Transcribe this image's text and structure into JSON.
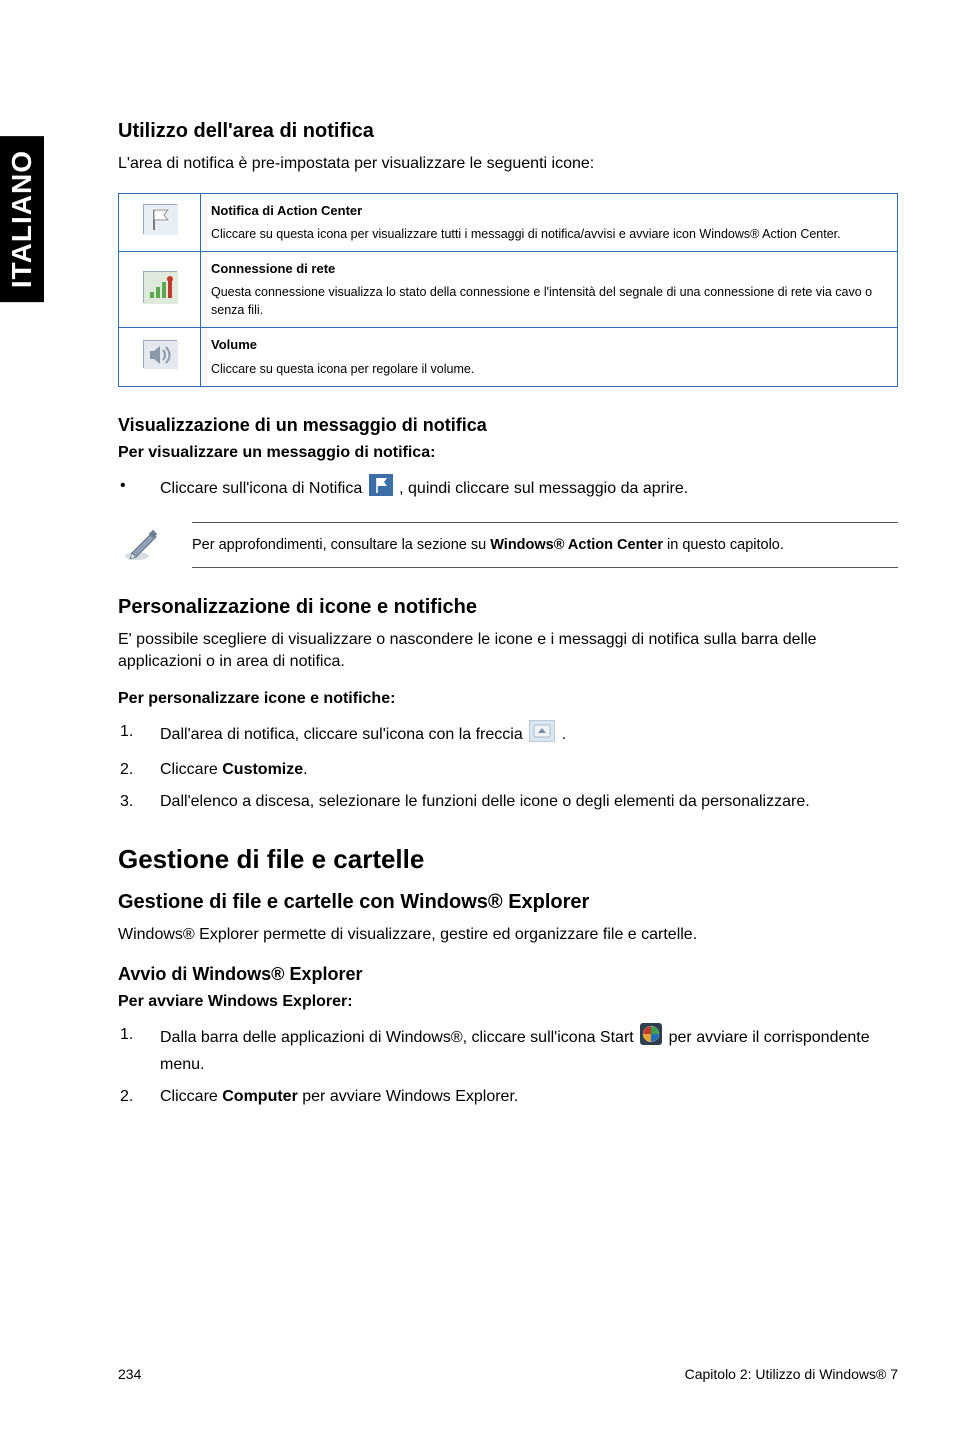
{
  "side_tab": "ITALIANO",
  "section1": {
    "heading": "Utilizzo dell'area di notifica",
    "intro": "L'area di notifica è pre-impostata per visualizzare le seguenti icone:"
  },
  "table": {
    "rows": [
      {
        "title": "Notifica di Action Center",
        "desc": "Cliccare su questa icona per visualizzare tutti i messaggi di notifica/avvisi e avviare icon Windows® Action Center."
      },
      {
        "title": "Connessione di rete",
        "desc": "Questa connessione visualizza lo stato della connessione e l'intensità del segnale di una connessione di rete via cavo o senza fili."
      },
      {
        "title": "Volume",
        "desc": "Cliccare su questa icona per regolare il volume."
      }
    ]
  },
  "section2": {
    "heading": "Visualizzazione di un messaggio di notifica",
    "subheading": "Per visualizzare un messaggio di notifica:",
    "bullet_pre": "Cliccare sull'icona di Notifica ",
    "bullet_post": ", quindi cliccare sul messaggio da aprire."
  },
  "note": {
    "pre": "Per approfondimenti, consultare la sezione su ",
    "bold": "Windows® Action Center",
    "post": " in questo capitolo."
  },
  "section3": {
    "heading": "Personalizzazione di icone e notifiche",
    "intro": "E' possibile scegliere di visualizzare o nascondere le icone e i messaggi di notifica sulla barra delle applicazioni o in area di notifica.",
    "subheading": "Per personalizzare icone e notifiche:",
    "steps": [
      {
        "pre": "Dall'area di notifica, cliccare sul'icona con la freccia ",
        "post": "."
      },
      {
        "pre": "Cliccare ",
        "bold": "Customize",
        "post": "."
      },
      {
        "pre": "Dall'elenco a discesa, selezionare le funzioni delle icone o degli elementi da personalizzare."
      }
    ]
  },
  "section4": {
    "big_heading": "Gestione di file e cartelle",
    "heading": "Gestione di file e cartelle con Windows® Explorer",
    "intro": "Windows® Explorer permette di visualizzare, gestire ed organizzare file e cartelle.",
    "sub_heading2": "Avvio di Windows® Explorer",
    "sub_heading2b": "Per avviare Windows Explorer:",
    "steps": [
      {
        "pre": "Dalla barra delle applicazioni di Windows®, cliccare sull'icona Start ",
        "post": " per avviare il corrispondente menu."
      },
      {
        "pre": "Cliccare ",
        "bold": "Computer",
        "post": " per avviare Windows Explorer."
      }
    ]
  },
  "footer": {
    "page_num": "234",
    "chapter": "Capitolo 2: Utilizzo di Windows® 7"
  }
}
